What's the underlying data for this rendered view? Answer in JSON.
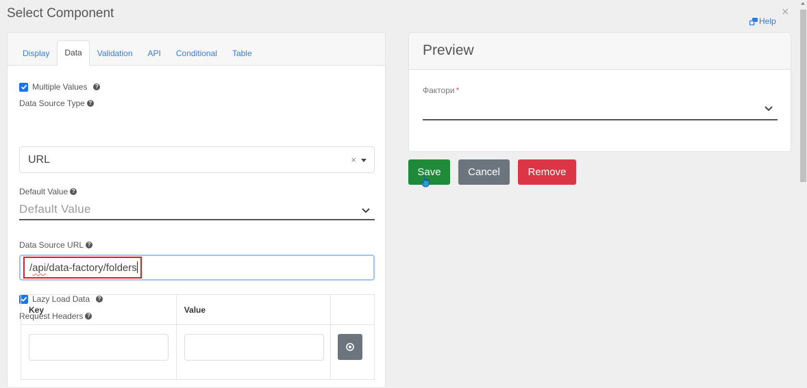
{
  "modal": {
    "title": "Select Component",
    "help_label": "Help",
    "close_icon": "close-icon"
  },
  "tabs": [
    {
      "label": "Display",
      "active": false
    },
    {
      "label": "Data",
      "active": true
    },
    {
      "label": "Validation",
      "active": false
    },
    {
      "label": "API",
      "active": false
    },
    {
      "label": "Conditional",
      "active": false
    },
    {
      "label": "Table",
      "active": false
    }
  ],
  "form": {
    "multiple_values": {
      "label": "Multiple Values",
      "checked": true
    },
    "data_source_type": {
      "label": "Data Source Type",
      "value": "URL"
    },
    "default_value": {
      "label": "Default Value",
      "placeholder": "Default Value"
    },
    "data_source_url": {
      "label": "Data Source URL",
      "value_prefix": "/",
      "value_squiggle": "api",
      "value_rest": "/data-factory/folders"
    },
    "lazy_load": {
      "label": "Lazy Load Data",
      "checked": true
    },
    "request_headers": {
      "label": "Request Headers",
      "columns": [
        "Key",
        "Value"
      ],
      "rows": [
        {
          "key": "",
          "value": ""
        }
      ]
    }
  },
  "preview": {
    "title": "Preview",
    "field_label": "Фактори",
    "required_marker": "*"
  },
  "actions": {
    "save": "Save",
    "cancel": "Cancel",
    "remove": "Remove"
  },
  "colors": {
    "accent": "#2f7be0",
    "save": "#1e8a3a",
    "cancel": "#6c757d",
    "remove": "#dc3545",
    "highlight_box": "#e01b2a"
  }
}
